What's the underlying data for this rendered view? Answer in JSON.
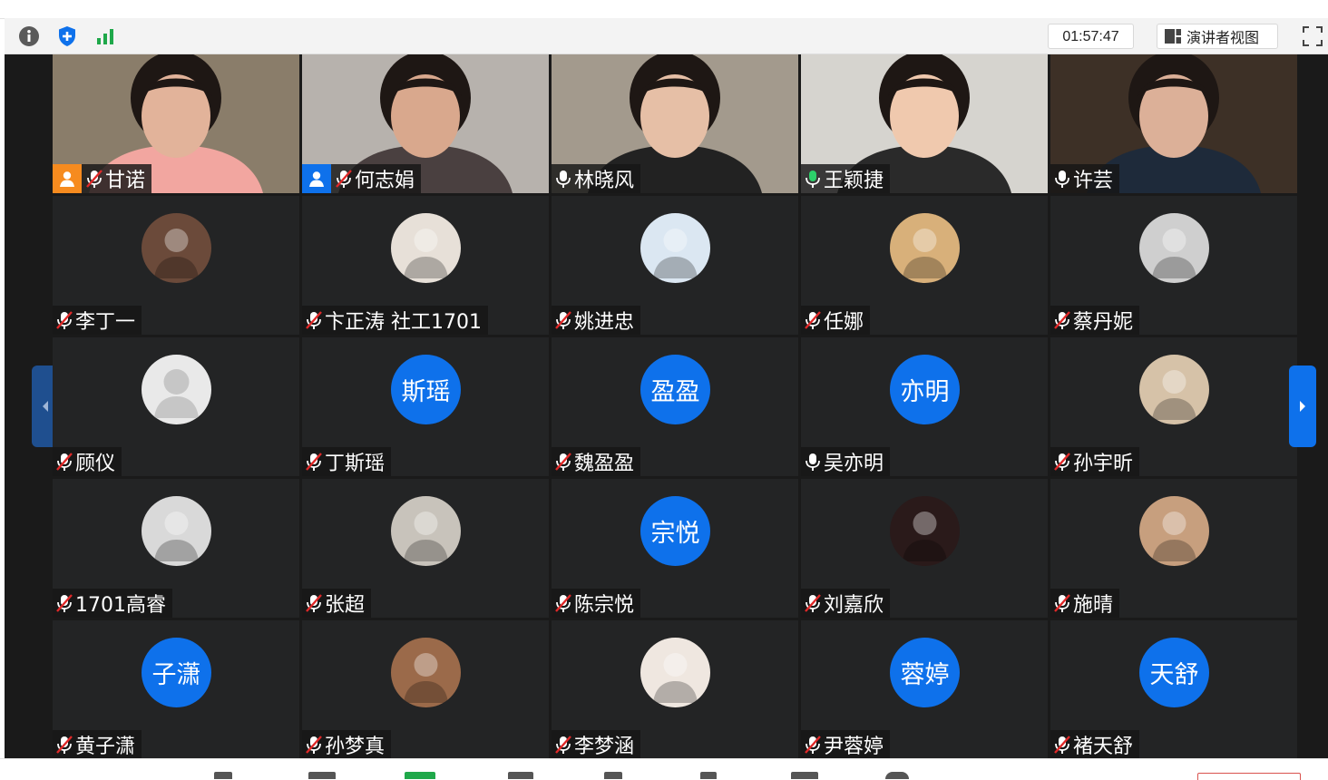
{
  "toolbar": {
    "timer": "01:57:47",
    "view_button_label": "演讲者视图",
    "info_icon": "info-icon",
    "shield_icon": "shield-icon",
    "signal_icon": "signal-bars-icon",
    "fullscreen_icon": "fullscreen-icon"
  },
  "colors": {
    "accent": "#0e71eb",
    "active_speaker": "#2cd06a",
    "tile_bg": "#232425"
  },
  "participants": [
    {
      "name": "甘诺",
      "type": "video",
      "mic": "muted",
      "host_badge": "orange"
    },
    {
      "name": "何志娟",
      "type": "video",
      "mic": "muted",
      "host_badge": "blue"
    },
    {
      "name": "林晓风",
      "type": "video",
      "mic": "on"
    },
    {
      "name": "王颖捷",
      "type": "video",
      "mic": "speaking",
      "active": true
    },
    {
      "name": "许芸",
      "type": "video",
      "mic": "on"
    },
    {
      "name": "李丁一",
      "type": "photo",
      "mic": "muted"
    },
    {
      "name": "卞正涛 社工1701",
      "type": "photo",
      "mic": "muted"
    },
    {
      "name": "姚进忠",
      "type": "photo",
      "mic": "muted"
    },
    {
      "name": "任娜",
      "type": "photo",
      "mic": "muted"
    },
    {
      "name": "蔡丹妮",
      "type": "photo",
      "mic": "muted"
    },
    {
      "name": "顾仪",
      "type": "default",
      "mic": "muted"
    },
    {
      "name": "丁斯瑶",
      "type": "text",
      "initials": "斯瑶",
      "mic": "muted"
    },
    {
      "name": "魏盈盈",
      "type": "text",
      "initials": "盈盈",
      "mic": "muted"
    },
    {
      "name": "吴亦明",
      "type": "text",
      "initials": "亦明",
      "mic": "on"
    },
    {
      "name": "孙宇昕",
      "type": "photo",
      "mic": "muted"
    },
    {
      "name": "1701高睿",
      "type": "photo",
      "mic": "muted"
    },
    {
      "name": "张超",
      "type": "photo",
      "mic": "muted"
    },
    {
      "name": "陈宗悦",
      "type": "text",
      "initials": "宗悦",
      "mic": "muted"
    },
    {
      "name": "刘嘉欣",
      "type": "photo",
      "mic": "muted"
    },
    {
      "name": "施晴",
      "type": "photo",
      "mic": "muted"
    },
    {
      "name": "黄子潇",
      "type": "text",
      "initials": "子潇",
      "mic": "muted"
    },
    {
      "name": "孙梦真",
      "type": "photo",
      "mic": "muted"
    },
    {
      "name": "李梦涵",
      "type": "photo",
      "mic": "muted"
    },
    {
      "name": "尹蓉婷",
      "type": "text",
      "initials": "蓉婷",
      "mic": "muted"
    },
    {
      "name": "褚天舒",
      "type": "text",
      "initials": "天舒",
      "mic": "muted"
    }
  ]
}
